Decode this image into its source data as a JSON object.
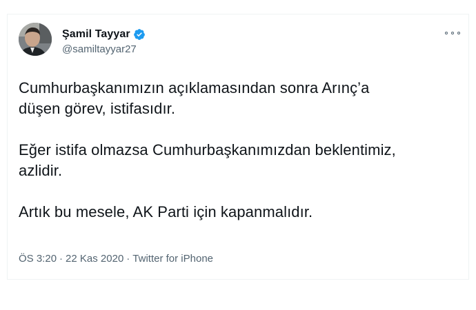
{
  "tweet": {
    "author": {
      "display_name": "Şamil Tayyar",
      "username": "@samiltayyar27",
      "verified": true,
      "verified_color": "#1d9bf0"
    },
    "body": {
      "paragraph_1_line_1": "Cumhurbaşkanımızın açıklamasından sonra Arınç’a",
      "paragraph_1_line_2": "düşen görev, istifasıdır.",
      "paragraph_2_line_1": "Eğer istifa olmazsa Cumhurbaşkanımızdan beklentimiz,",
      "paragraph_2_line_2": "azlidir.",
      "paragraph_3_line_1": "Artık bu mesele, AK Parti için kapanmalıdır."
    },
    "meta": {
      "time": "ÖS 3:20",
      "date": "22 Kas 2020",
      "source": "Twitter for iPhone",
      "separator": "·"
    },
    "icons": {
      "more": "more-options-icon",
      "verified": "verified-badge-icon"
    }
  }
}
